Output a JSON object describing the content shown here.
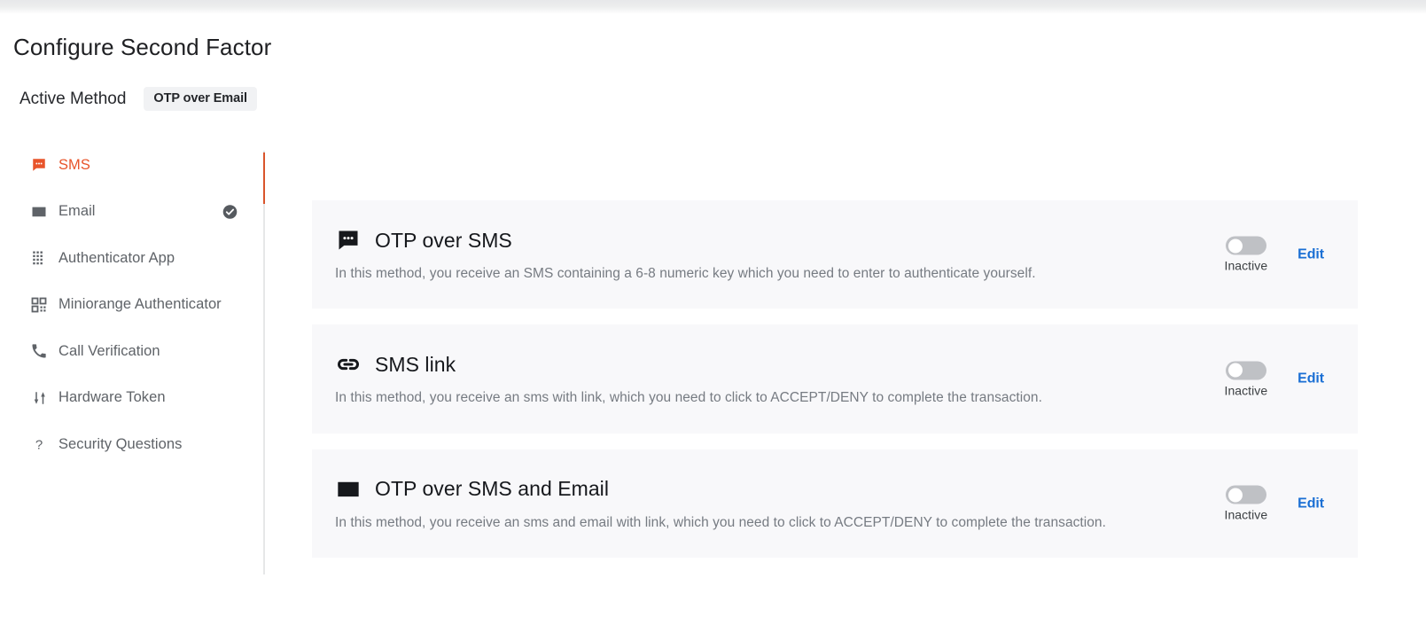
{
  "page": {
    "title": "Configure Second Factor"
  },
  "active_method": {
    "label": "Active Method",
    "value": "OTP over Email"
  },
  "colors": {
    "accent_orange": "#e8542a",
    "link_blue": "#1a6fd4",
    "card_bg": "#f8f8fa",
    "muted_text": "#767b82",
    "toggle_off": "#bfc1c5"
  },
  "sidebar": {
    "items": [
      {
        "label": "SMS",
        "icon": "sms-chat-icon",
        "active": true,
        "checked": false
      },
      {
        "label": "Email",
        "icon": "envelope-icon",
        "active": false,
        "checked": true
      },
      {
        "label": "Authenticator App",
        "icon": "grid-dots-icon",
        "active": false,
        "checked": false
      },
      {
        "label": "Miniorange Authenticator",
        "icon": "qr-code-icon",
        "active": false,
        "checked": false
      },
      {
        "label": "Call Verification",
        "icon": "phone-icon",
        "active": false,
        "checked": false
      },
      {
        "label": "Hardware Token",
        "icon": "hardware-token-icon",
        "active": false,
        "checked": false
      },
      {
        "label": "Security Questions",
        "icon": "question-mark-icon",
        "active": false,
        "checked": false
      }
    ]
  },
  "methods": [
    {
      "title": "OTP over SMS",
      "icon": "sms-chat-icon",
      "description": "In this method, you receive an SMS containing a 6-8 numeric key which you need to enter to authenticate yourself.",
      "toggle_state": "Inactive",
      "toggle_on": false,
      "edit_label": "Edit"
    },
    {
      "title": "SMS link",
      "icon": "link-icon",
      "description": "In this method, you receive an sms with link, which you need to click to ACCEPT/DENY to complete the transaction.",
      "toggle_state": "Inactive",
      "toggle_on": false,
      "edit_label": "Edit"
    },
    {
      "title": "OTP over SMS and Email",
      "icon": "envelope-icon",
      "description": "In this method, you receive an sms and email with link, which you need to click to ACCEPT/DENY to complete the transaction.",
      "toggle_state": "Inactive",
      "toggle_on": false,
      "edit_label": "Edit"
    }
  ]
}
